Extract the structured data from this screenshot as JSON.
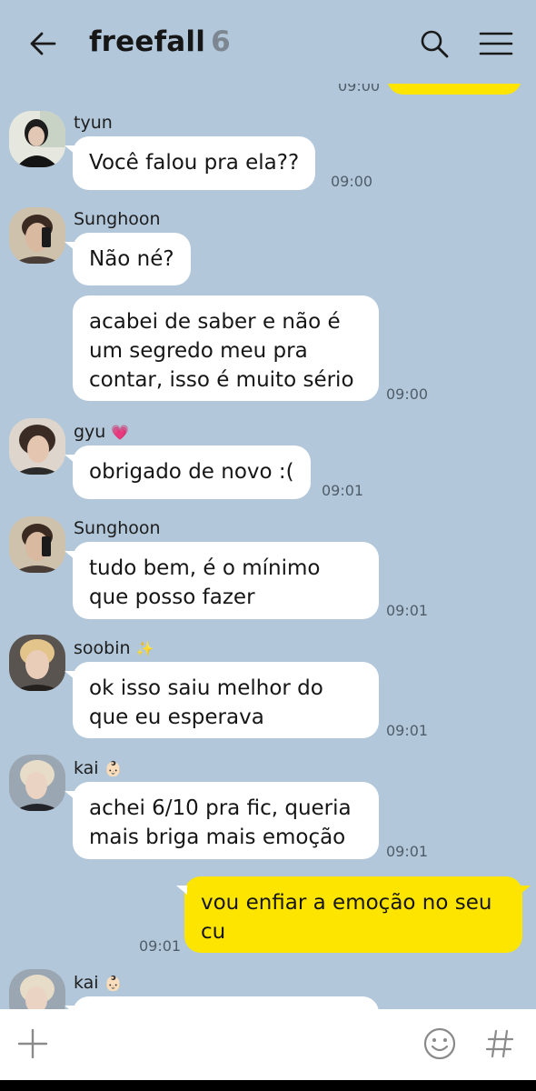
{
  "header": {
    "title": "freefall",
    "member_count": "6"
  },
  "partial_top_time": "09:00",
  "messages": [
    {
      "sender": "tyun",
      "text": "Você falou pra ela??",
      "time": "09:00"
    },
    {
      "sender": "Sunghoon",
      "text": "Não né?"
    },
    {
      "text": "acabei de saber e não é um segredo meu pra contar, isso é muito sério",
      "time": "09:00"
    },
    {
      "sender": "gyu",
      "sender_emoji": "💗",
      "text": "obrigado de novo :(",
      "time": "09:01"
    },
    {
      "sender": "Sunghoon",
      "text": "tudo bem, é o mínimo que posso fazer",
      "time": "09:01"
    },
    {
      "sender": "soobin",
      "sender_emoji": "✨",
      "text": "ok isso saiu melhor do que eu esperava",
      "time": "09:01"
    },
    {
      "sender": "kai",
      "sender_emoji": "👶🏻",
      "text": "achei 6/10 pra fic, queria mais briga mais emoção",
      "time": "09:01"
    },
    {
      "text": "vou enfiar a emoção no seu cu",
      "time": "09:01"
    },
    {
      "sender": "kai",
      "sender_emoji": "👶🏻"
    }
  ],
  "colors": {
    "background": "#b2c7d9",
    "my_bubble": "#fee500",
    "other_bubble": "#ffffff"
  },
  "icons": {
    "back": "arrow-left-icon",
    "search": "search-icon",
    "menu": "hamburger-menu-icon",
    "attach": "plus-icon",
    "emoji": "smiley-icon",
    "hashtag": "hash-icon"
  }
}
